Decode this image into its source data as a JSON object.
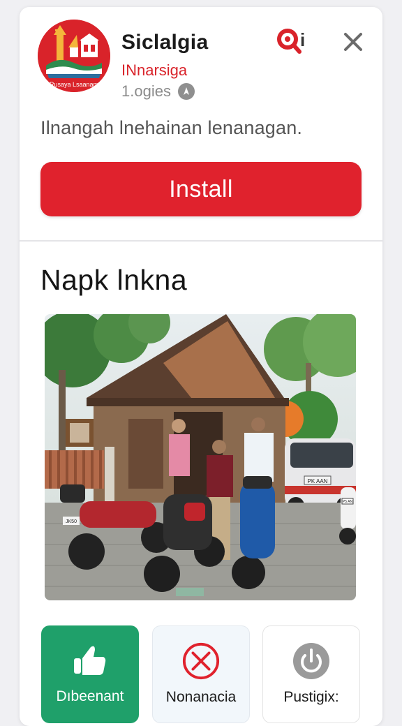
{
  "app": {
    "name": "Siclalgia",
    "developer": "INnarsiga",
    "rating_text": "1.ogies",
    "logo_text": "Rusaya Lsaanam"
  },
  "icons": {
    "search": "search-magnifier-icon",
    "info": "i",
    "close": "close-icon",
    "rating": "rating-badge-icon"
  },
  "description": "Ilnangah lnehainan lenanagan.",
  "install_label": "Install",
  "section_title": "Napk lnkna",
  "photo": {
    "plate_left": "JK50",
    "plate_right": "PK AAN",
    "plate_far": "P5 AN"
  },
  "tiles": [
    {
      "label": "Dıbeenant",
      "icon": "thumbs-up-icon"
    },
    {
      "label": "Nonanacia",
      "icon": "cross-circle-icon"
    },
    {
      "label": "Pustigix:",
      "icon": "power-icon"
    }
  ],
  "colors": {
    "accent": "#e0222d",
    "developer": "#d9232a",
    "tile_green": "#1fa06a"
  }
}
